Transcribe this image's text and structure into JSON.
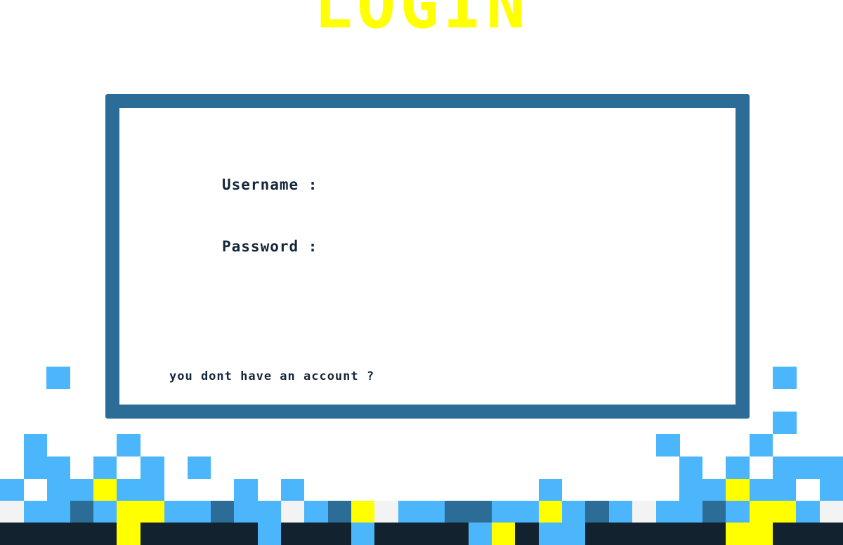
{
  "header": {
    "title": "LOGIN"
  },
  "form": {
    "username_label": "Username :",
    "password_label": "Password :",
    "username_value": "",
    "password_value": "",
    "signup_prompt": "you dont have an account ?"
  },
  "colors": {
    "title": "#ffff00",
    "frame_border": "#2b6d97",
    "text_dark": "#15263a",
    "pixel_light_blue": "#4bb6fb",
    "pixel_mid_blue": "#2b6d97",
    "pixel_yellow": "#ffff00",
    "pixel_off_white": "#f3f3f3",
    "pixel_navy": "#12222f"
  }
}
